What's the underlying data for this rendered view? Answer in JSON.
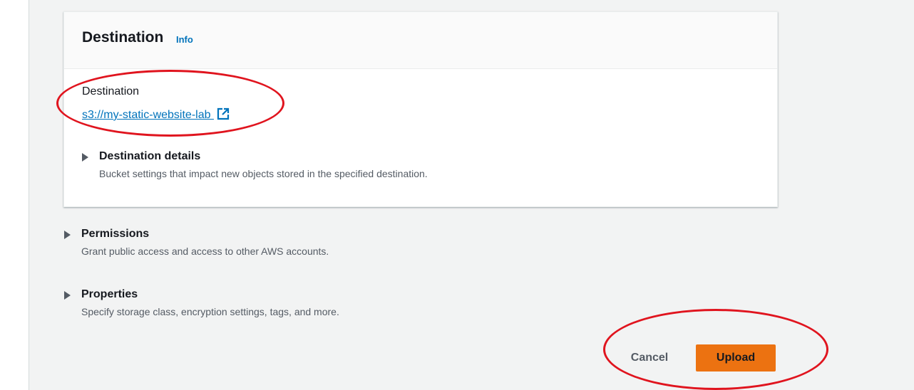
{
  "destination_card": {
    "title": "Destination",
    "info_link": "Info",
    "field_label": "Destination",
    "destination_url": "s3://my-static-website-lab",
    "details": {
      "title": "Destination details",
      "description": "Bucket settings that impact new objects stored in the specified destination."
    }
  },
  "sections": {
    "permissions": {
      "title": "Permissions",
      "description": "Grant public access and access to other AWS accounts."
    },
    "properties": {
      "title": "Properties",
      "description": "Specify storage class, encryption settings, tags, and more."
    }
  },
  "actions": {
    "cancel_label": "Cancel",
    "upload_label": "Upload"
  },
  "icons": {
    "external_link": "external-link-icon",
    "expand": "caret-right-icon"
  },
  "colors": {
    "link": "#0073bb",
    "primary_button": "#ec7211",
    "annotation": "#e0141e",
    "background": "#f2f3f3"
  }
}
